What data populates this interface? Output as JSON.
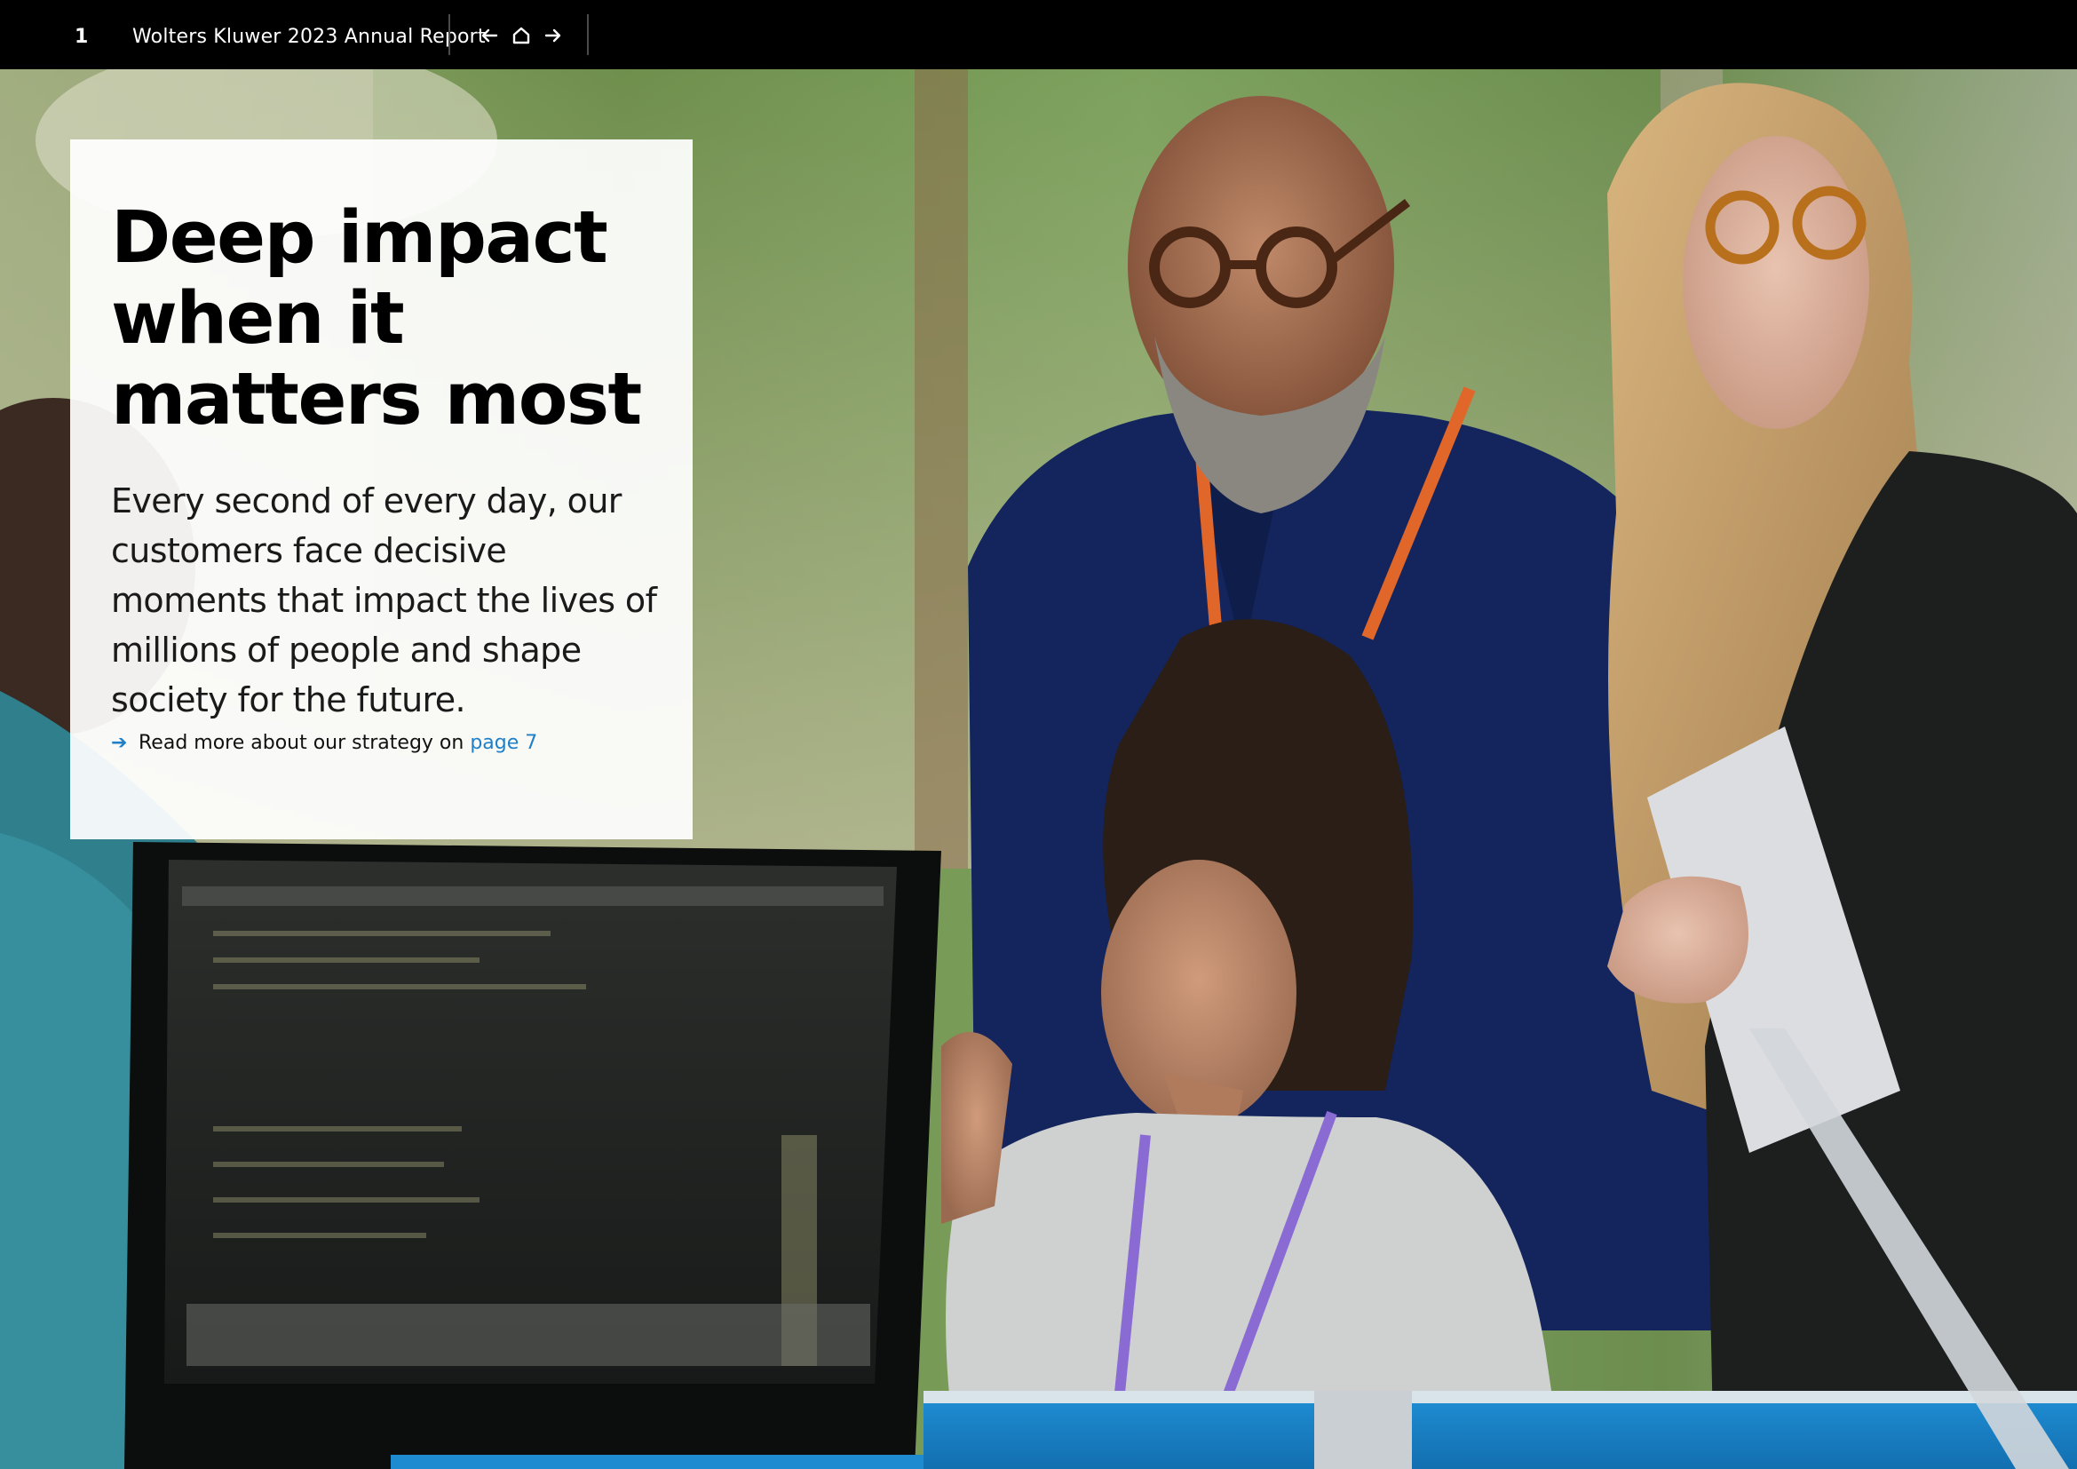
{
  "header": {
    "page_number": "1",
    "report_title": "Wolters Kluwer 2023 Annual Report",
    "nav": {
      "back_icon": "arrow-left-icon",
      "home_icon": "home-icon",
      "forward_icon": "arrow-right-icon"
    }
  },
  "hero": {
    "headline": "Deep impact when it matters most",
    "intro": "Every second of every day, our customers face decisive moments that impact the lives of millions of people and shape society for the future.",
    "read_more": {
      "icon": "arrow-right-icon",
      "text": "Read more about our strategy on",
      "link_text": "page 7"
    }
  },
  "colors": {
    "topbar": "#000000",
    "link": "#1f7fc8",
    "panel": "#ffffff"
  }
}
